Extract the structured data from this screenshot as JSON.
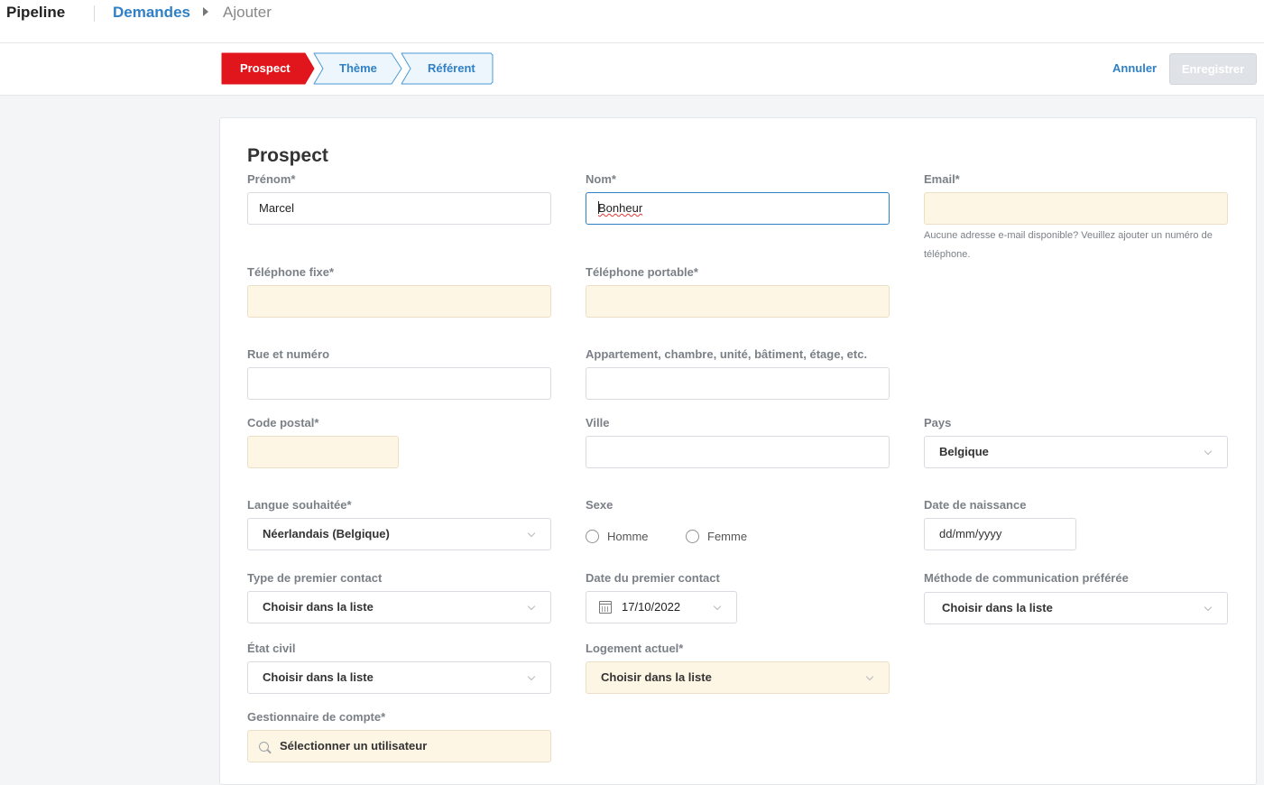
{
  "header": {
    "app_name": "Pipeline",
    "breadcrumb_link": "Demandes",
    "breadcrumb_current": "Ajouter"
  },
  "steps": [
    {
      "label": "Prospect",
      "active": true
    },
    {
      "label": "Thème",
      "active": false
    },
    {
      "label": "Référent",
      "active": false
    }
  ],
  "actions": {
    "cancel": "Annuler",
    "save": "Enregistrer"
  },
  "colors": {
    "accent": "#2f80c6",
    "active_step": "#e0161c",
    "required_field": "#fef6e4"
  },
  "form": {
    "title": "Prospect",
    "prenom": {
      "label": "Prénom*",
      "value": "Marcel"
    },
    "nom": {
      "label": "Nom*",
      "value": "Bonheur"
    },
    "email": {
      "label": "Email*",
      "value": "",
      "hint": "Aucune adresse e-mail disponible? Veuillez ajouter un numéro de téléphone."
    },
    "telephone_fixe": {
      "label": "Téléphone fixe*",
      "value": ""
    },
    "telephone_portable": {
      "label": "Téléphone portable*",
      "value": ""
    },
    "rue": {
      "label": "Rue et numéro",
      "value": ""
    },
    "appartement": {
      "label": "Appartement, chambre, unité, bâtiment, étage, etc.",
      "value": ""
    },
    "code_postal": {
      "label": "Code postal*",
      "value": ""
    },
    "ville": {
      "label": "Ville",
      "value": ""
    },
    "pays": {
      "label": "Pays",
      "value": "Belgique"
    },
    "langue": {
      "label": "Langue souhaitée*",
      "value": "Néerlandais (Belgique)"
    },
    "sexe": {
      "label": "Sexe",
      "options": [
        "Homme",
        "Femme"
      ]
    },
    "date_naissance": {
      "label": "Date de naissance",
      "placeholder": "dd/mm/yyyy"
    },
    "type_contact": {
      "label": "Type de premier contact",
      "value": "Choisir dans la liste"
    },
    "date_contact": {
      "label": "Date du premier contact",
      "value": "17/10/2022"
    },
    "methode": {
      "label": "Méthode de communication préférée",
      "value": "Choisir dans la liste"
    },
    "etat_civil": {
      "label": "État civil",
      "value": "Choisir dans la liste"
    },
    "logement": {
      "label": "Logement actuel*",
      "value": "Choisir dans la liste"
    },
    "gestionnaire": {
      "label": "Gestionnaire de compte*",
      "placeholder": "Sélectionner un utilisateur"
    }
  }
}
